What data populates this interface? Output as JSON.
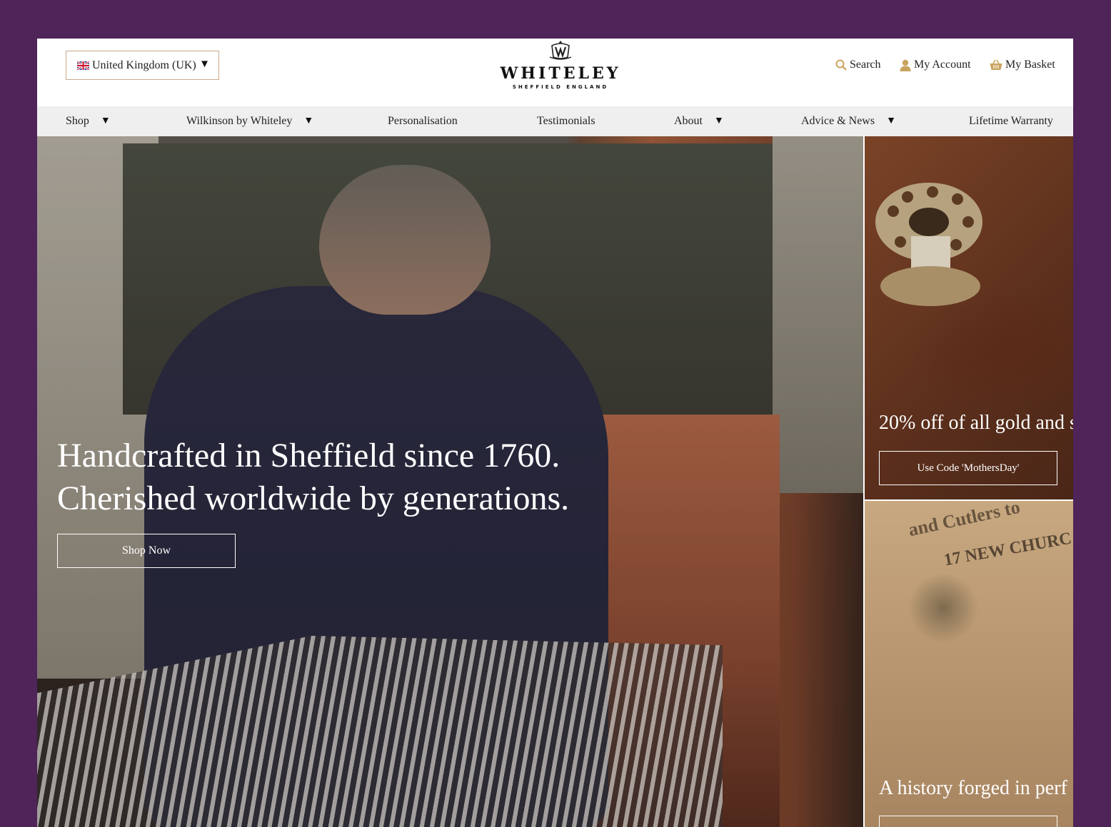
{
  "header": {
    "country_selector": {
      "label": "United Kingdom (UK)",
      "flag_icon": "uk-flag-icon"
    },
    "logo": {
      "name": "WHITELEY",
      "subtitle": "SHEFFIELD ENGLAND"
    },
    "utilities": [
      {
        "label": "Search",
        "icon": "search-icon"
      },
      {
        "label": "My Account",
        "icon": "user-icon"
      },
      {
        "label": "My Basket",
        "icon": "basket-icon"
      }
    ]
  },
  "nav": {
    "items": [
      {
        "label": "Shop",
        "has_dropdown": true
      },
      {
        "label": "Wilkinson by Whiteley",
        "has_dropdown": true
      },
      {
        "label": "Personalisation",
        "has_dropdown": false
      },
      {
        "label": "Testimonials",
        "has_dropdown": false
      },
      {
        "label": "About",
        "has_dropdown": true
      },
      {
        "label": "Advice & News",
        "has_dropdown": true
      },
      {
        "label": "Lifetime Warranty",
        "has_dropdown": false
      }
    ]
  },
  "hero": {
    "title_line1": "Handcrafted in Sheffield since 1760.",
    "title_line2": "Cherished worldwide by generations.",
    "button_label": "Shop Now"
  },
  "promos": [
    {
      "title": "20% off of all gold and s",
      "button_label": "Use Code 'MothersDay'"
    },
    {
      "title": "A history forged in perf",
      "button_label": ""
    }
  ],
  "colors": {
    "frame_background": "#4e2459",
    "accent_gold": "#c9a35f",
    "nav_background": "#efefef"
  }
}
